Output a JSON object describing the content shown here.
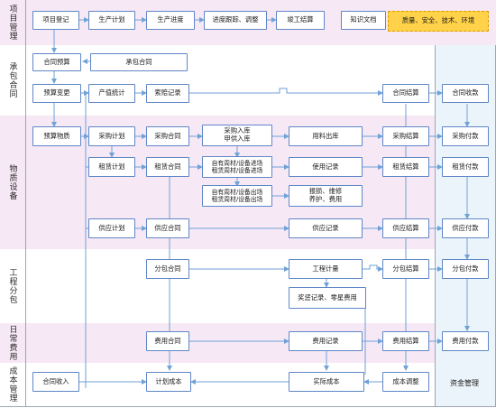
{
  "colors": {
    "pink_band": "#f7e8f5",
    "white_band": "#ffffff",
    "finance_column": "#ecf4fb",
    "node_border": "#5f86c6",
    "arrow": "#6fa2d6",
    "highlight_fill": "#ffd24a"
  },
  "lanes": {
    "project": "项目管理",
    "contract": "承包合同",
    "material": "物质设备",
    "subcontract": "工程分包",
    "daily": "日常费用",
    "cost": "成本管理"
  },
  "nodes": {
    "project_register": "项目登记",
    "production_plan": "生产计划",
    "production_progress": "生产进度",
    "progress_tracking": "进度跟踪、调整",
    "completion_settlement": "竣工结算",
    "knowledge_docs": "知识文档",
    "quality_safety": "质量、安全、技术、环境",
    "contract_budget": "合同预算",
    "contract_main": "承包合同",
    "budget_change": "预算变更",
    "output_stats": "产值统计",
    "claims_record": "索赔记录",
    "contract_settlement": "合同结算",
    "contract_receipt": "合同收款",
    "budget_materials": "预算物质",
    "purchase_plan": "采购计划",
    "purchase_contract": "采购合同",
    "purchase_inbound": "采购入库\n甲供入库",
    "material_outbound": "用料出库",
    "purchase_settlement": "采购结算",
    "purchase_payment": "采购付款",
    "lease_plan": "租赁计划",
    "lease_contract": "租赁合同",
    "equipment_in": "自有周材/设备进场\n租赁周材/设备进场",
    "usage_record": "使用记录",
    "lease_settlement": "租赁结算",
    "lease_payment": "租赁付款",
    "equipment_out": "自有周材/设备出场\n租赁周材/设备出场",
    "scrap_repair": "报损、维修\n养护、费用",
    "supply_plan": "供应计划",
    "supply_contract": "供应合同",
    "supply_record": "供应记录",
    "supply_settlement": "供应结算",
    "supply_payment": "供应付款",
    "sub_contract": "分包合同",
    "work_measure": "工程计量",
    "sub_settlement": "分包结算",
    "sub_payment": "分包付款",
    "reward_record": "奖惩记录、零星费用",
    "expense_contract": "费用合同",
    "expense_record": "费用记录",
    "expense_settlement": "费用结算",
    "expense_payment": "费用付款",
    "contract_income": "合同收入",
    "planned_cost": "计划成本",
    "actual_cost": "实际成本",
    "cost_adjust": "成本调整",
    "fund_management": "资金管理"
  }
}
